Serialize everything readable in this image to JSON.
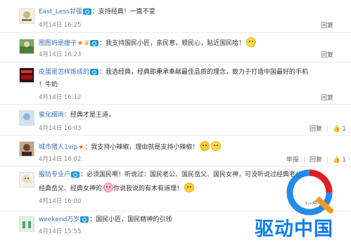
{
  "comments": [
    {
      "username": "East_Less甘强",
      "badge": "verified-icon",
      "text": "：支持经典！一直不变",
      "time": "4月14日 16:25",
      "actions": {
        "reply": "回复"
      }
    },
    {
      "username": "图图妈是瘦子",
      "badge": "verified-icon",
      "text": "：我支持国民小匠，亲民意，顺民心，贴近国民哈！",
      "time": "4月14日 16:23",
      "actions": {
        "reply": "回复"
      }
    },
    {
      "username": "皮蛋是怎样炼成的",
      "badge": "verified-icon",
      "text": "：我选经典，经典即秉承奉献最佳品质的理念，致力于打造中国最好的手机",
      "text2": "！牛奶",
      "time": "4月14日 16:12",
      "actions": {
        "reply": "回复"
      }
    },
    {
      "username": "蜜化细雨",
      "text": "：经典才是王道。",
      "time": "4月14日 16:03",
      "actions": {
        "reply": "回复",
        "likes": "1"
      }
    },
    {
      "username": "城市猎人1vip",
      "text": "：我支持小辣椒，理由就是支持小辣椒！",
      "time": "4月14日 16:02",
      "actions": {
        "report": "举报",
        "reply": "回复",
        "likes": "1"
      }
    },
    {
      "username": "服防专业户",
      "badge": "verified-icon",
      "text": "：必须国民啊！听说过：国民老公、国民岳父、国民女神，可没听说过经典老公、",
      "text2a": "经典岳父、经典女神的",
      "text2b": "你说我说的有木有道理！",
      "time": "4月14日 16:00",
      "actions": {
        "reply": "回复"
      }
    },
    {
      "username": "weekend万岁",
      "badge": "verified-icon",
      "text": "：国民小匠，国民精神的引领",
      "time": "4月14日 15:55",
      "actions": {}
    }
  ],
  "watermark": {
    "text": "驱动中国",
    "colors": {
      "blue": "#0c7ee8",
      "red": "#e02020",
      "orange": "#f39a1e"
    }
  }
}
